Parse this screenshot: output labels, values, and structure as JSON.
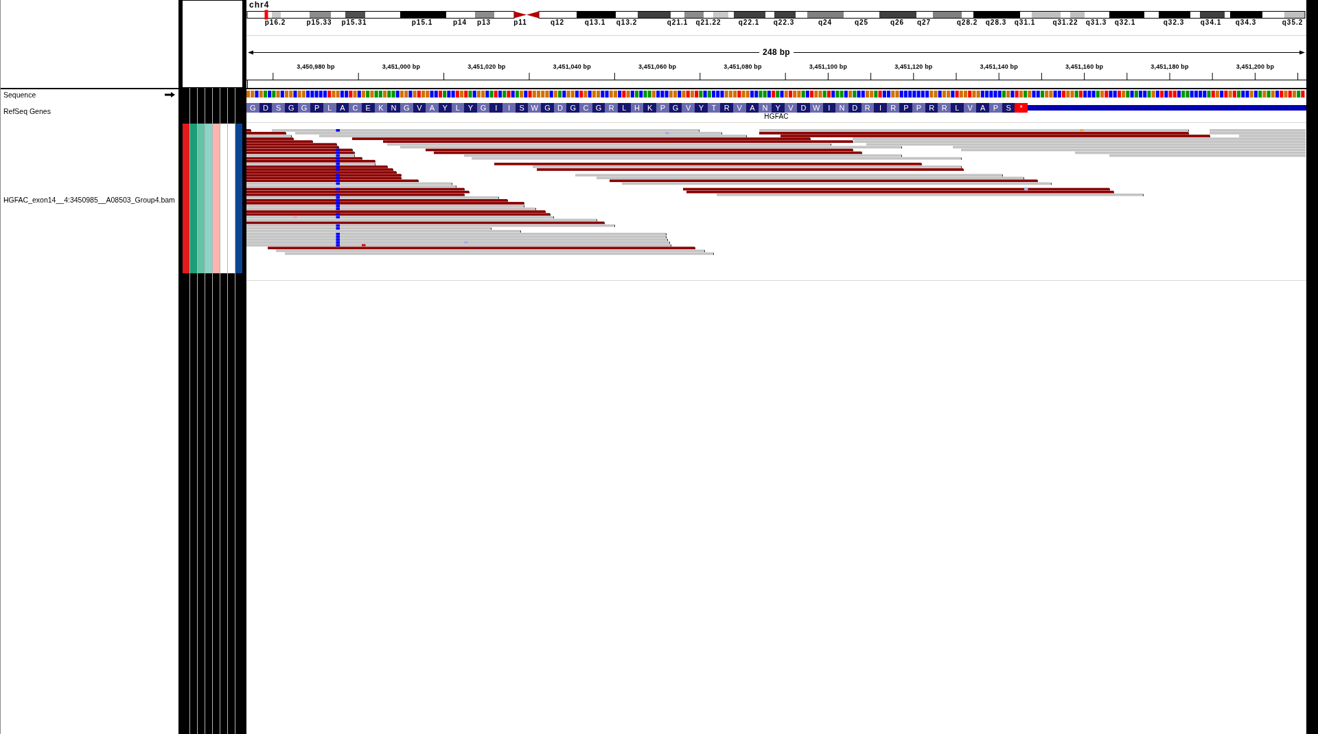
{
  "ideogram": {
    "chromosome": "chr4",
    "band_labels": [
      "p16.2",
      "p15.33",
      "p15.31",
      "p15.1",
      "p14",
      "p13",
      "p11",
      "q12",
      "q13.1",
      "q13.2",
      "q21.1",
      "q21.22",
      "q22.1",
      "q22.3",
      "q24",
      "q25",
      "q26",
      "q27",
      "q28.2",
      "q28.3",
      "q31.1",
      "q31.22",
      "q31.3",
      "q32.1",
      "q32.3",
      "q34.1",
      "q34.3",
      "q35.2"
    ]
  },
  "ruler": {
    "span": "248 bp",
    "tick_labels": [
      "3,450,980 bp",
      "3,451,000 bp",
      "3,451,020 bp",
      "3,451,040 bp",
      "3,451,060 bp",
      "3,451,080 bp",
      "3,451,100 bp",
      "3,451,120 bp",
      "3,451,140 bp",
      "3,451,160 bp",
      "3,451,180 bp",
      "3,451,200 bp"
    ]
  },
  "attributes": [
    {
      "color": "#e41a1c"
    },
    {
      "color": "#1b9e77"
    },
    {
      "color": "#66c2a5"
    },
    {
      "color": "#8dd3c7"
    },
    {
      "color": "#fbb4ae"
    },
    {
      "color": "#ffffff"
    },
    {
      "color": "#ffffff"
    },
    {
      "color": "#0c4494"
    }
  ],
  "tracks": [
    {
      "kind": "sequence",
      "name": "Sequence",
      "forward_strand": true
    },
    {
      "kind": "gene",
      "name": "RefSeq Genes",
      "gene": "HGFAC",
      "amino_acids": [
        "G",
        "D",
        "S",
        "G",
        "G",
        "P",
        "L",
        "A",
        "C",
        "E",
        "K",
        "N",
        "G",
        "V",
        "A",
        "Y",
        "L",
        "Y",
        "G",
        "I",
        "I",
        "S",
        "W",
        "G",
        "D",
        "G",
        "C",
        "G",
        "R",
        "L",
        "H",
        "K",
        "P",
        "G",
        "V",
        "Y",
        "T",
        "R",
        "V",
        "A",
        "N",
        "Y",
        "V",
        "D",
        "W",
        "I",
        "N",
        "D",
        "R",
        "I",
        "R",
        "P",
        "P",
        "R",
        "R",
        "L",
        "V",
        "A",
        "P",
        "S"
      ],
      "stop_codon": "*"
    },
    {
      "kind": "alignment",
      "name": "HGFAC_exon14__4:3450985__A08503_Group4.bam"
    }
  ]
}
